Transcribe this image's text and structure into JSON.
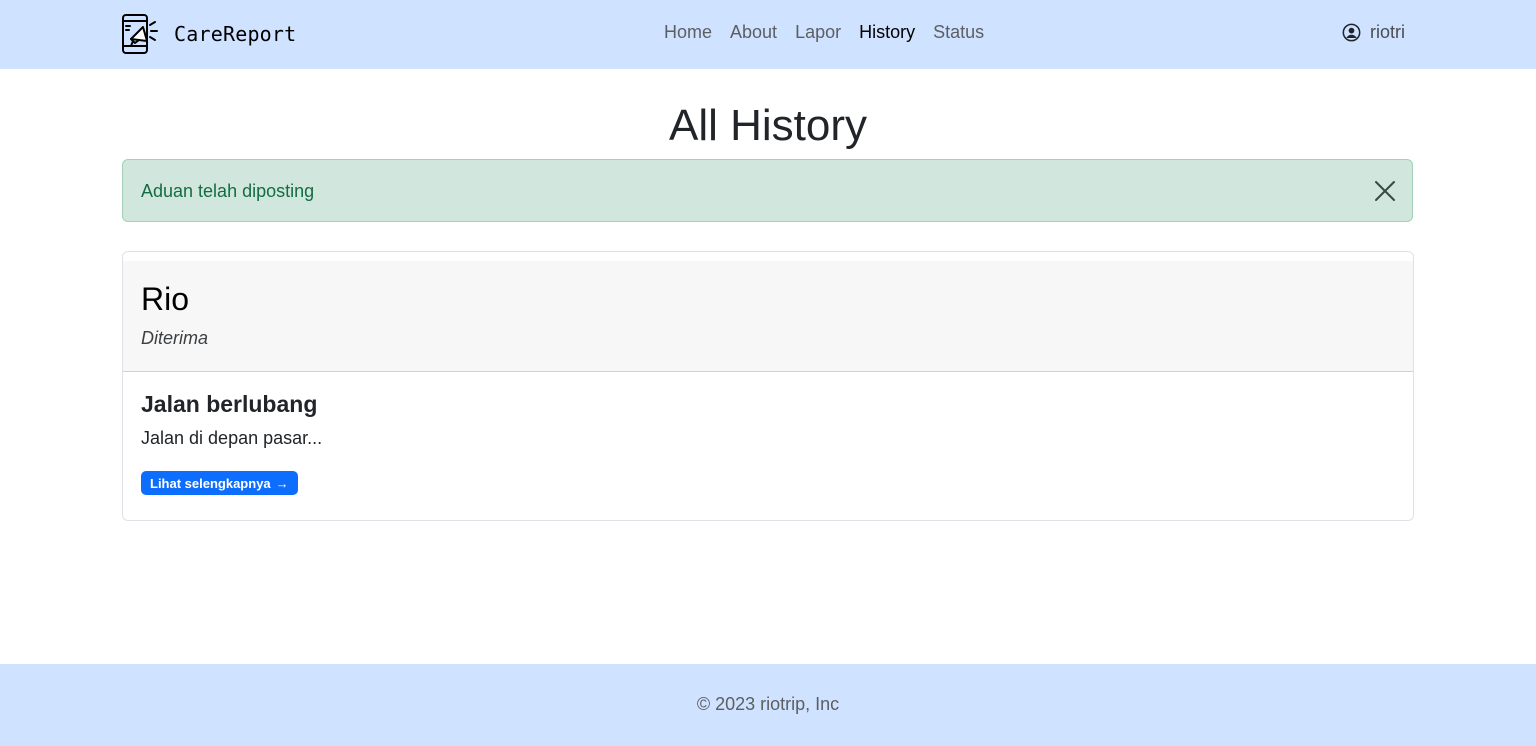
{
  "navbar": {
    "brand": "CareReport",
    "brand_icon": "megaphone-phone-logo",
    "links": [
      {
        "label": "Home",
        "active": false
      },
      {
        "label": "About",
        "active": false
      },
      {
        "label": "Lapor",
        "active": false
      },
      {
        "label": "History",
        "active": true
      },
      {
        "label": "Status",
        "active": false
      }
    ],
    "user": {
      "name": "riotri",
      "icon": "user-circle-icon"
    },
    "background": "#cfe2ff"
  },
  "page": {
    "title": "All History"
  },
  "alert": {
    "message": "Aduan telah diposting",
    "close_icon": "close-icon",
    "type": "success"
  },
  "history": [
    {
      "name": "Rio",
      "status": "Diterima",
      "title": "Jalan berlubang",
      "excerpt": "Jalan di depan pasar...",
      "button": "Lihat selengkapnya",
      "button_icon": "arrow-right-icon"
    }
  ],
  "footer": {
    "text": "© 2023 riotrip, Inc",
    "background": "#cfe2ff"
  }
}
